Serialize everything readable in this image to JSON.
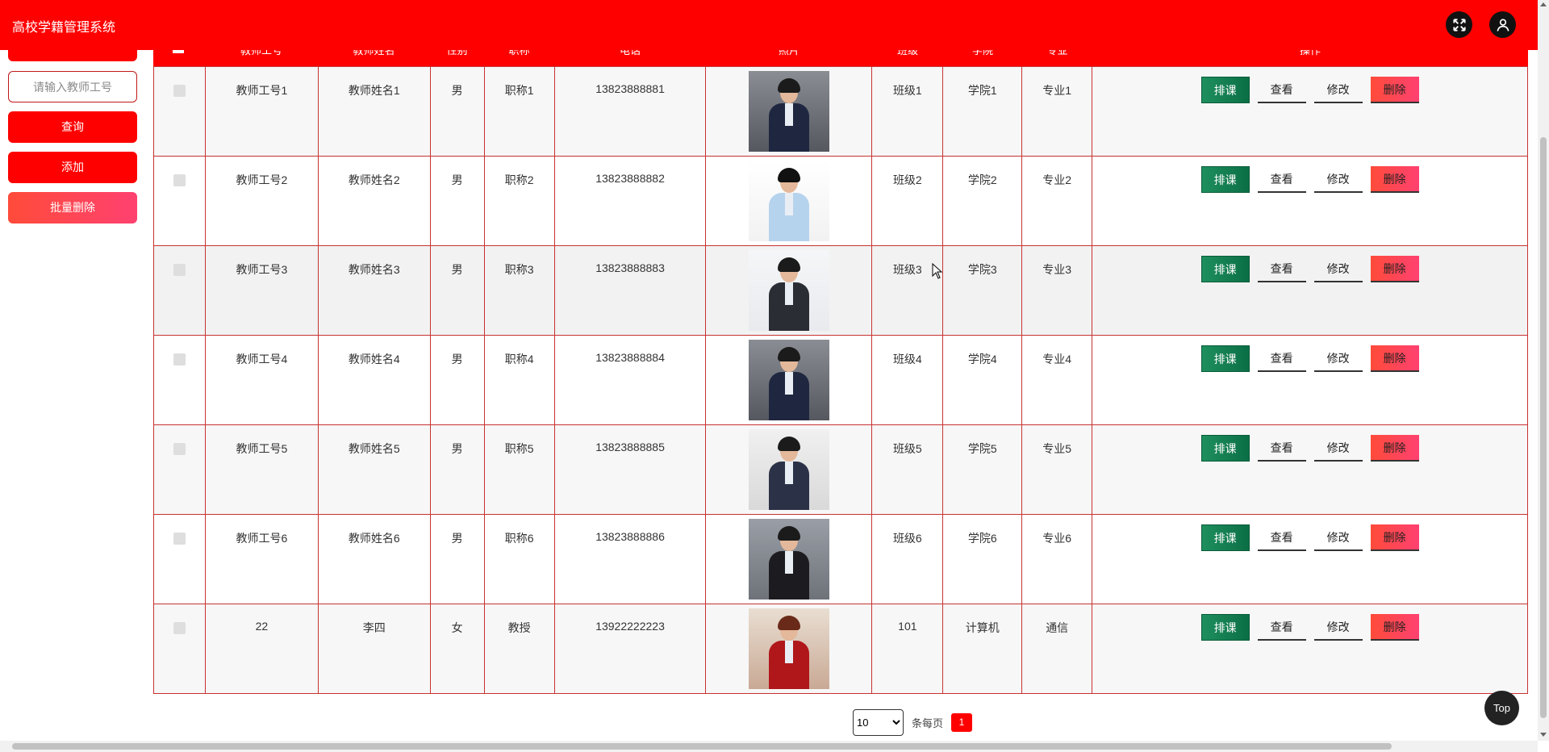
{
  "header": {
    "title": "高校学籍管理系统"
  },
  "sidebar": {
    "search_placeholder": "请输入教师工号",
    "query_label": "查询",
    "add_label": "添加",
    "batch_delete_label": "批量删除"
  },
  "table": {
    "columns": [
      "教师工号",
      "教师姓名",
      "性别",
      "职称",
      "电话",
      "照片",
      "班级",
      "学院",
      "专业",
      "操作"
    ],
    "rows": [
      {
        "id": "教师工号1",
        "name": "教师姓名1",
        "gender": "男",
        "title": "职称1",
        "phone": "13823888881",
        "class": "班级1",
        "college": "学院1",
        "major": "专业1"
      },
      {
        "id": "教师工号2",
        "name": "教师姓名2",
        "gender": "男",
        "title": "职称2",
        "phone": "13823888882",
        "class": "班级2",
        "college": "学院2",
        "major": "专业2"
      },
      {
        "id": "教师工号3",
        "name": "教师姓名3",
        "gender": "男",
        "title": "职称3",
        "phone": "13823888883",
        "class": "班级3",
        "college": "学院3",
        "major": "专业3"
      },
      {
        "id": "教师工号4",
        "name": "教师姓名4",
        "gender": "男",
        "title": "职称4",
        "phone": "13823888884",
        "class": "班级4",
        "college": "学院4",
        "major": "专业4"
      },
      {
        "id": "教师工号5",
        "name": "教师姓名5",
        "gender": "男",
        "title": "职称5",
        "phone": "13823888885",
        "class": "班级5",
        "college": "学院5",
        "major": "专业5"
      },
      {
        "id": "教师工号6",
        "name": "教师姓名6",
        "gender": "男",
        "title": "职称6",
        "phone": "13823888886",
        "class": "班级6",
        "college": "学院6",
        "major": "专业6"
      },
      {
        "id": "22",
        "name": "李四",
        "gender": "女",
        "title": "教授",
        "phone": "13922222223",
        "class": "101",
        "college": "计算机",
        "major": "通信"
      }
    ],
    "actions": {
      "schedule": "排课",
      "view": "查看",
      "edit": "修改",
      "delete": "删除"
    }
  },
  "pagination": {
    "page_size": "10",
    "per_page_label": "条每页",
    "current_page": "1"
  },
  "top_button": "Top",
  "colors": {
    "primary": "#ff0000",
    "schedule": "#0b6e45",
    "delete": "#ff4170"
  }
}
